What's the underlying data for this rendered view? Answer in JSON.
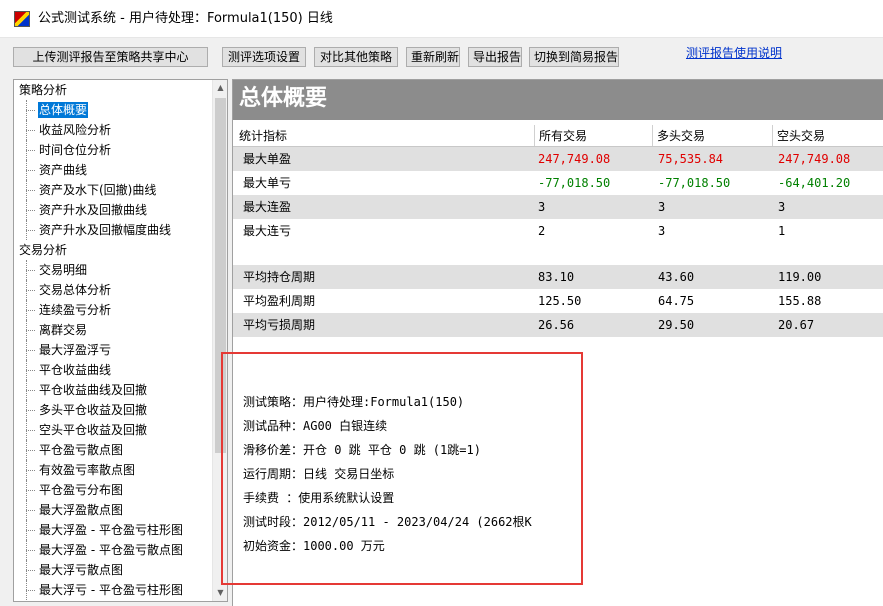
{
  "window": {
    "title": "公式测试系统 - 用户待处理：Formula1(150) 日线"
  },
  "toolbar": {
    "buttons": [
      "上传测评报告至策略共享中心",
      "测评选项设置",
      "对比其他策略",
      "重新刷新",
      "导出报告",
      "切换到简易报告"
    ],
    "help_link": "测评报告使用说明"
  },
  "tree": {
    "groups": [
      {
        "label": "策略分析",
        "items": [
          "总体概要",
          "收益风险分析",
          "时间仓位分析",
          "资产曲线",
          "资产及水下(回撤)曲线",
          "资产升水及回撤曲线",
          "资产升水及回撤幅度曲线"
        ]
      },
      {
        "label": "交易分析",
        "items": [
          "交易明细",
          "交易总体分析",
          "连续盈亏分析",
          "离群交易",
          "最大浮盈浮亏",
          "平仓收益曲线",
          "平仓收益曲线及回撤",
          "多头平仓收益及回撤",
          "空头平仓收益及回撤",
          "平仓盈亏散点图",
          "有效盈亏率散点图",
          "平仓盈亏分布图",
          "最大浮盈散点图",
          "最大浮盈 - 平仓盈亏柱形图",
          "最大浮盈 - 平仓盈亏散点图",
          "最大浮亏散点图",
          "最大浮亏 - 平仓盈亏柱形图"
        ]
      }
    ],
    "selected": "总体概要"
  },
  "panel": {
    "title": "总体概要"
  },
  "table": {
    "headers": [
      "统计指标",
      "所有交易",
      "多头交易",
      "空头交易"
    ],
    "rows": [
      {
        "label": "最大单盈",
        "values": [
          "247,749.08",
          "75,535.84",
          "247,749.08"
        ]
      },
      {
        "label": "最大单亏",
        "values": [
          "-77,018.50",
          "-77,018.50",
          "-64,401.20"
        ]
      },
      {
        "label": "最大连盈",
        "values": [
          "3",
          "3",
          "3"
        ]
      },
      {
        "label": "最大连亏",
        "values": [
          "2",
          "3",
          "1"
        ]
      },
      {
        "label": "平均持仓周期",
        "values": [
          "83.10",
          "43.60",
          "119.00"
        ]
      },
      {
        "label": "平均盈利周期",
        "values": [
          "125.50",
          "64.75",
          "155.88"
        ]
      },
      {
        "label": "平均亏损周期",
        "values": [
          "26.56",
          "29.50",
          "20.67"
        ]
      }
    ]
  },
  "info": {
    "lines": [
      "测试策略：用户待处理:Formula1(150)",
      "测试品种：AG00 白银连续",
      "滑移价差：开仓 0 跳 平仓 0 跳 (1跳=1)",
      "运行周期：日线 交易日坐标",
      "手续费  ：使用系统默认设置",
      "测试时段：2012/05/11 - 2023/04/24 (2662根K",
      "初始资金：1000.00 万元"
    ]
  },
  "colors": {
    "positive": "#e00000",
    "negative": "#008000",
    "highlight_box": "#e53935",
    "selection": "#0078d7"
  },
  "icons": [
    "app-icon",
    "scroll-up-arrow-icon",
    "scroll-down-arrow-icon"
  ]
}
